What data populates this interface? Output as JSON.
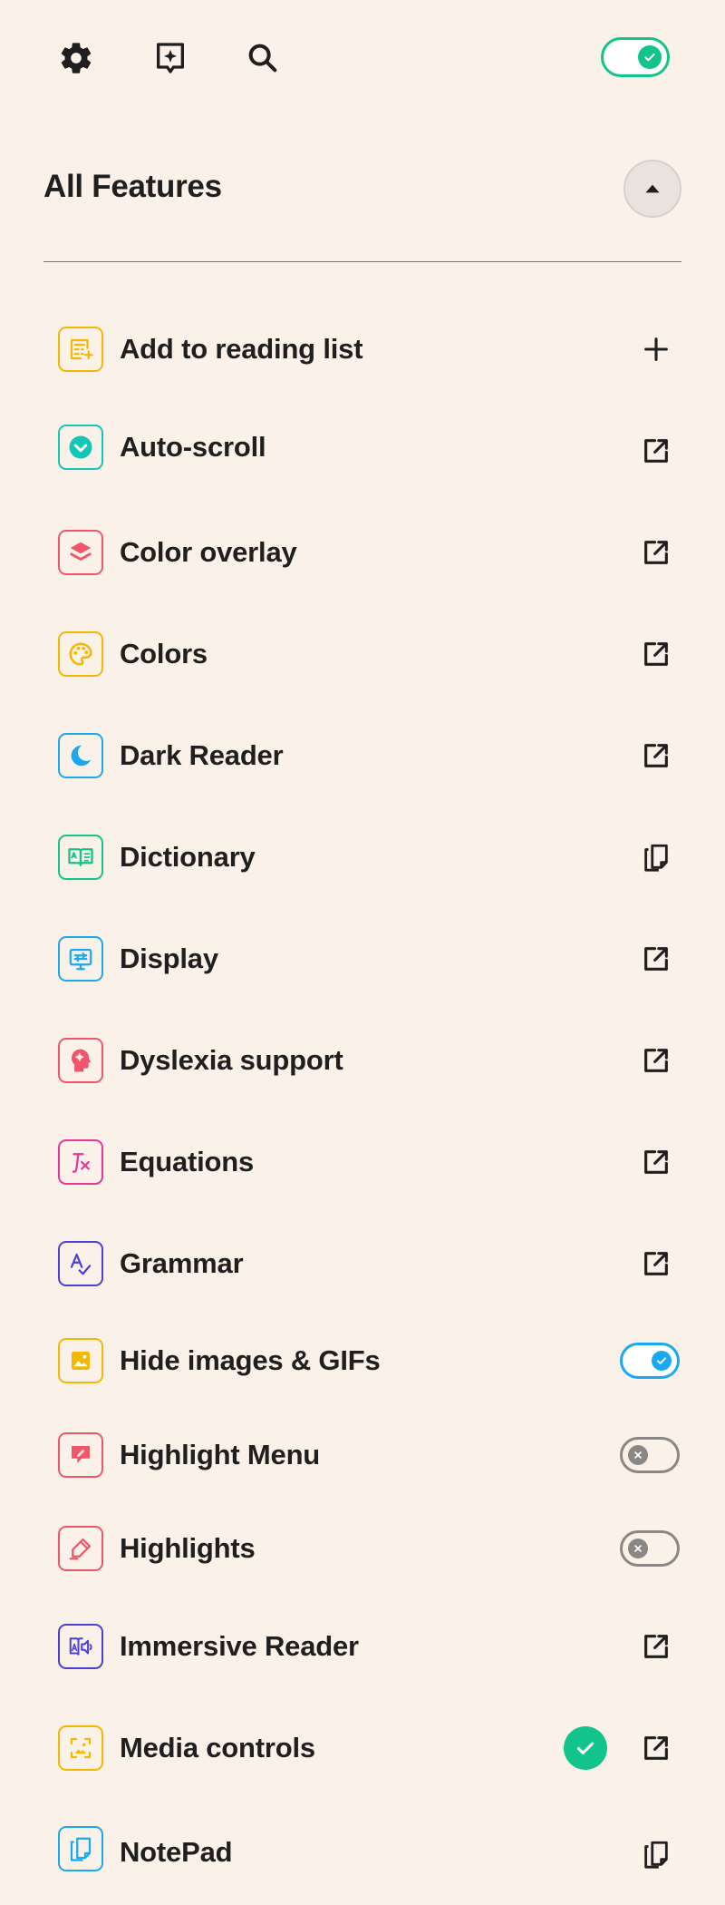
{
  "topbar": {
    "icons": [
      "gear-icon",
      "sparkle-bubble-icon",
      "search-icon"
    ],
    "master_toggle": {
      "state": "on",
      "color": "#12c48b"
    }
  },
  "section": {
    "title": "All Features",
    "collapse_icon": "caret-up-icon"
  },
  "features": [
    {
      "label": "Add to reading list",
      "icon": "reading-list-add-icon",
      "color": "#f5b800",
      "action": "plus"
    },
    {
      "label": "Auto-scroll",
      "icon": "auto-scroll-icon",
      "color": "#14c6b5",
      "action": "external"
    },
    {
      "label": "Color overlay",
      "icon": "layers-icon",
      "color": "#f0566b",
      "action": "external"
    },
    {
      "label": "Colors",
      "icon": "palette-icon",
      "color": "#f5b800",
      "action": "external"
    },
    {
      "label": "Dark Reader",
      "icon": "moon-icon",
      "color": "#1aa8f0",
      "action": "external"
    },
    {
      "label": "Dictionary",
      "icon": "dictionary-book-icon",
      "color": "#12c48b",
      "action": "copy"
    },
    {
      "label": "Display",
      "icon": "display-settings-icon",
      "color": "#1aa8f0",
      "action": "external"
    },
    {
      "label": "Dyslexia support",
      "icon": "brain-head-icon",
      "color": "#f0566b",
      "action": "external"
    },
    {
      "label": "Equations",
      "icon": "function-icon",
      "color": "#e8359a",
      "action": "external"
    },
    {
      "label": "Grammar",
      "icon": "grammar-check-icon",
      "color": "#4b3fd6",
      "action": "external"
    },
    {
      "label": "Hide images & GIFs",
      "icon": "image-icon",
      "color": "#f5b800",
      "action": "toggle",
      "state": "on"
    },
    {
      "label": "Highlight Menu",
      "icon": "highlight-menu-icon",
      "color": "#f0566b",
      "action": "toggle",
      "state": "off"
    },
    {
      "label": "Highlights",
      "icon": "highlighter-pen-icon",
      "color": "#f0566b",
      "action": "toggle",
      "state": "off"
    },
    {
      "label": "Immersive Reader",
      "icon": "immersive-reader-icon",
      "color": "#4b3fd6",
      "action": "external"
    },
    {
      "label": "Media controls",
      "icon": "media-controls-icon",
      "color": "#f5b800",
      "action": "external",
      "badge": "check"
    },
    {
      "label": "NotePad",
      "icon": "notepad-icon",
      "color": "#1aa8f0",
      "action": "copy"
    }
  ]
}
